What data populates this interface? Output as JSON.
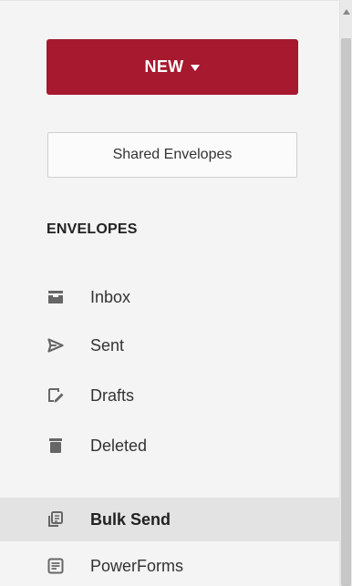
{
  "app": {
    "new_button_label": "NEW",
    "shared_button_label": "Shared Envelopes"
  },
  "sidebar": {
    "section_title": "ENVELOPES",
    "items": [
      {
        "key": "inbox",
        "label": "Inbox",
        "icon": "inbox-icon",
        "active": false
      },
      {
        "key": "sent",
        "label": "Sent",
        "icon": "send-icon",
        "active": false
      },
      {
        "key": "drafts",
        "label": "Drafts",
        "icon": "draft-icon",
        "active": false
      },
      {
        "key": "deleted",
        "label": "Deleted",
        "icon": "trash-icon",
        "active": false
      },
      {
        "key": "bulk_send",
        "label": "Bulk Send",
        "icon": "bulk-send-icon",
        "active": true
      },
      {
        "key": "powerforms",
        "label": "PowerForms",
        "icon": "powerforms-icon",
        "active": false
      }
    ]
  },
  "colors": {
    "primary_button": "#a6192e",
    "sidebar_background": "#f4f4f4",
    "active_item_background": "#e3e3e3",
    "icon_color": "#666666"
  }
}
